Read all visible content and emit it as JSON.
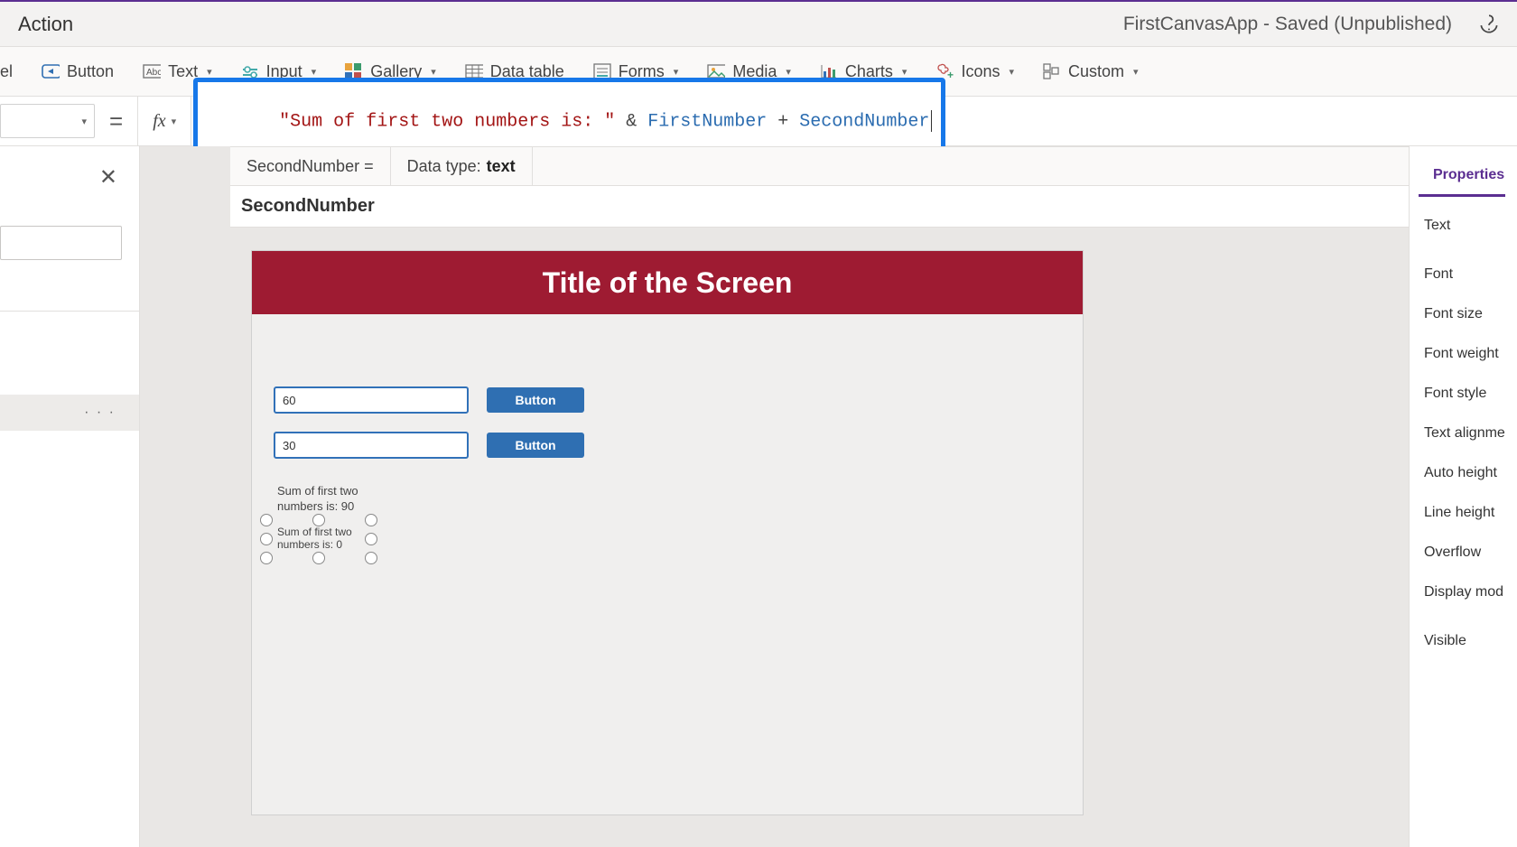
{
  "titlebar": {
    "tab": "Action",
    "status": "FirstCanvasApp - Saved (Unpublished)"
  },
  "ribbon": {
    "label_partial": "el",
    "button": "Button",
    "text": "Text",
    "input": "Input",
    "gallery": "Gallery",
    "datatable": "Data table",
    "forms": "Forms",
    "media": "Media",
    "charts": "Charts",
    "icons": "Icons",
    "custom": "Custom"
  },
  "formula": {
    "fx": "fx",
    "equals": "=",
    "string": "\"Sum of first two numbers is: \"",
    "amp": " & ",
    "var1": "FirstNumber",
    "plus": " + ",
    "var2": "SecondNumber"
  },
  "intellisense": {
    "current": "SecondNumber  =",
    "dtype_label": "Data type: ",
    "dtype_value": "text",
    "suggestion": "SecondNumber"
  },
  "left": {
    "ellipsis": "· · ·"
  },
  "canvas": {
    "title": "Title of the Screen",
    "input1": "60",
    "input2": "30",
    "button": "Button",
    "label1": "Sum of first two numbers is: 90",
    "label2": "Sum of first two numbers is: 0"
  },
  "props": {
    "tab": "Properties",
    "items": [
      "Text",
      "Font",
      "Font size",
      "Font weight",
      "Font style",
      "Text alignme",
      "Auto height",
      "Line height",
      "Overflow",
      "Display mod",
      "Visible"
    ]
  }
}
